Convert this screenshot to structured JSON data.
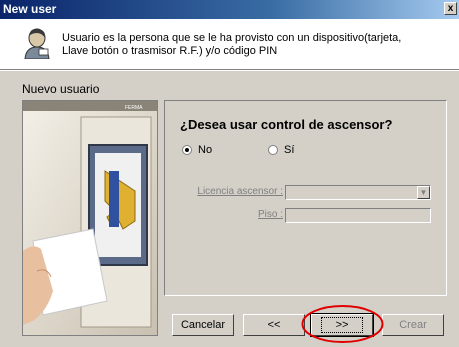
{
  "window": {
    "title": "New user",
    "close_glyph": "x"
  },
  "header": {
    "line1": "Usuario es la persona que se le ha provisto con un dispositivo(tarjeta,",
    "line2": "Llave botón o trasmisor R.F.) y/o código PIN",
    "icon": "user-icon"
  },
  "section": {
    "label": "Nuevo usuario"
  },
  "graphic": {
    "brand": "FERMA"
  },
  "form": {
    "question": "¿Desea usar control de ascensor?",
    "radio_no": "No",
    "radio_si": "Sí",
    "selected": "No",
    "licencia_label": "Licencia ascensor :",
    "licencia_value": "",
    "piso_label": "Piso :",
    "piso_value": ""
  },
  "buttons": {
    "cancel": "Cancelar",
    "back": "<<",
    "next": ">>",
    "create": "Crear"
  },
  "colors": {
    "titlebar": "#0a246a",
    "annotation": "#e00000",
    "face": "#d4d0c8"
  }
}
